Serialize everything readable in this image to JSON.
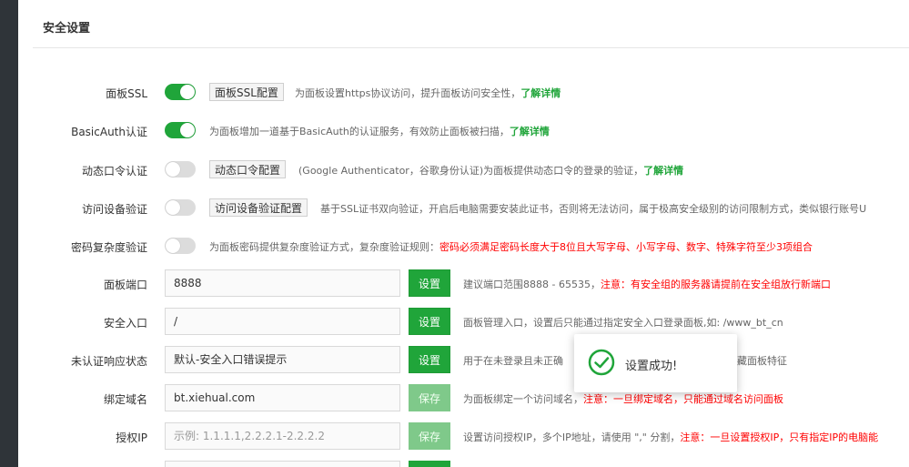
{
  "header": {
    "title": "安全设置"
  },
  "colors": {
    "accent": "#20a53a",
    "warn": "#ff0000",
    "strip": "#2f3439"
  },
  "rows": {
    "panel_ssl": {
      "label": "面板SSL",
      "button": "面板SSL配置",
      "desc": "为面板设置https协议访问，提升面板访问安全性，",
      "link": "了解详情"
    },
    "basic_auth": {
      "label": "BasicAuth认证",
      "desc": "为面板增加一道基于BasicAuth的认证服务，有效防止面板被扫描，",
      "link": "了解详情"
    },
    "dynamic_pwd": {
      "label": "动态口令认证",
      "button": "动态口令配置",
      "desc": "(Google Authenticator，谷歌身份认证)为面板提供动态口令的登录的验证，",
      "link": "了解详情"
    },
    "device_verify": {
      "label": "访问设备验证",
      "button": "访问设备验证配置",
      "desc": "基于SSL证书双向验证，开启后电脑需要安装此证书，否则将无法访问，属于极高安全级别的访问限制方式，类似银行账号U"
    },
    "pwd_complex": {
      "label": "密码复杂度验证",
      "desc": "为面板密码提供复杂度验证方式，复杂度验证规则：",
      "warn": "密码必须满足密码长度大于8位且大写字母、小写字母、数字、特殊字符至少3项组合"
    },
    "panel_port": {
      "label": "面板端口",
      "value": "8888",
      "button": "设置",
      "desc": "建议端口范围8888 - 65535，",
      "warn": "注意：有安全组的服务器请提前在安全组放行新端口"
    },
    "safe_entry": {
      "label": "安全入口",
      "value": "/",
      "button": "设置",
      "desc": "面板管理入口，设置后只能通过指定安全入口登录面板,如: /www_bt_cn"
    },
    "unauth_status": {
      "label": "未认证响应状态",
      "value": "默认-安全入口错误提示",
      "button": "设置",
      "desc": "用于在未登录且未正确",
      "desc_tail": "藏面板特征"
    },
    "bind_domain": {
      "label": "绑定域名",
      "value": "bt.xiehual.com",
      "button": "保存",
      "desc": "为面板绑定一个访问域名，",
      "warn": "注意：一旦绑定域名，只能通过域名访问面板"
    },
    "auth_ip": {
      "label": "授权IP",
      "placeholder": "示例: 1.1.1.1,2.2.2.1-2.2.2.2",
      "button": "保存",
      "desc": "设置访问授权IP，多个IP地址，请使用 \",\" 分割，",
      "warn": "注意：一旦设置授权IP，只有指定IP的电脑能"
    }
  },
  "toast": {
    "message": "设置成功!"
  }
}
